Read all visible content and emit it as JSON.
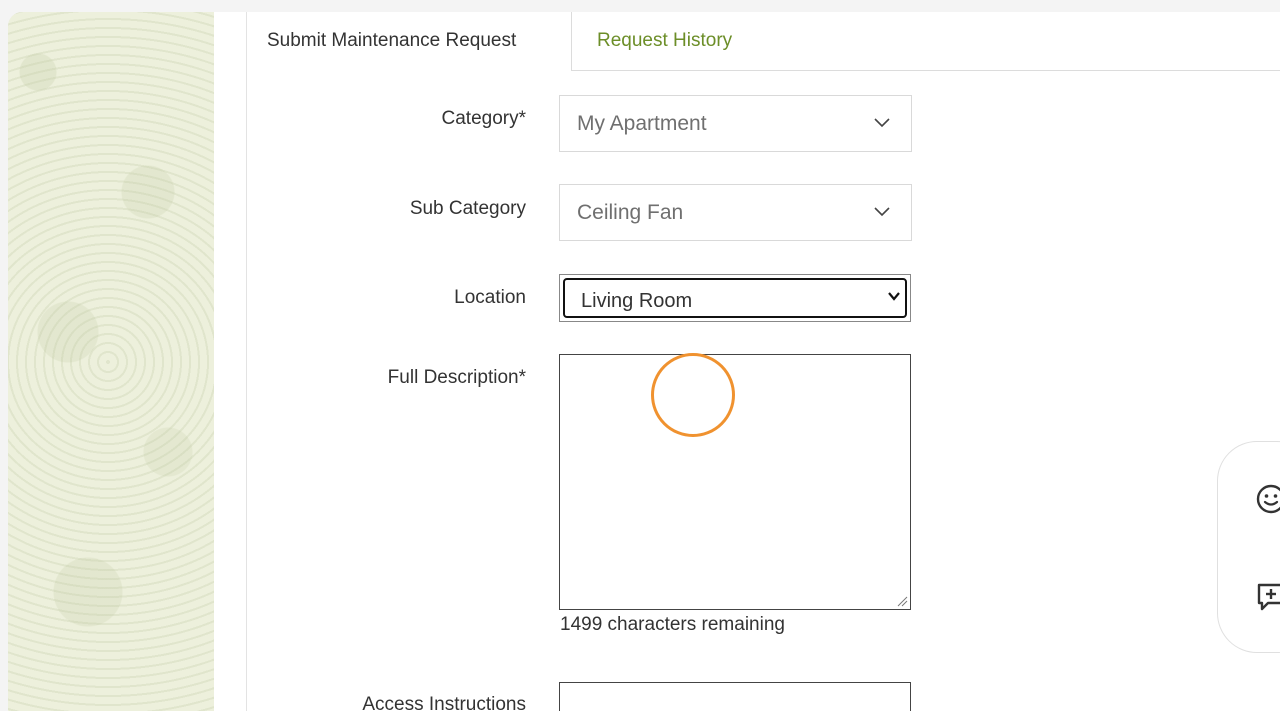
{
  "tabs": {
    "submit_label": "Submit Maintenance Request",
    "history_label": "Request History"
  },
  "form": {
    "category_label": "Category*",
    "category_value": "My Apartment",
    "subcategory_label": "Sub Category",
    "subcategory_value": "Ceiling Fan",
    "location_label": "Location",
    "location_value": "Living Room",
    "description_label": "Full Description*",
    "description_value": "",
    "chars_remaining": "1499 characters remaining",
    "access_label": "Access Instructions"
  },
  "feedback_widget": {
    "icons": [
      "smiley-icon",
      "add-comment-icon"
    ]
  },
  "colors": {
    "accent_link": "#6c8e28",
    "click_indicator": "#f0922f",
    "side_pattern": "#edf0dc"
  }
}
